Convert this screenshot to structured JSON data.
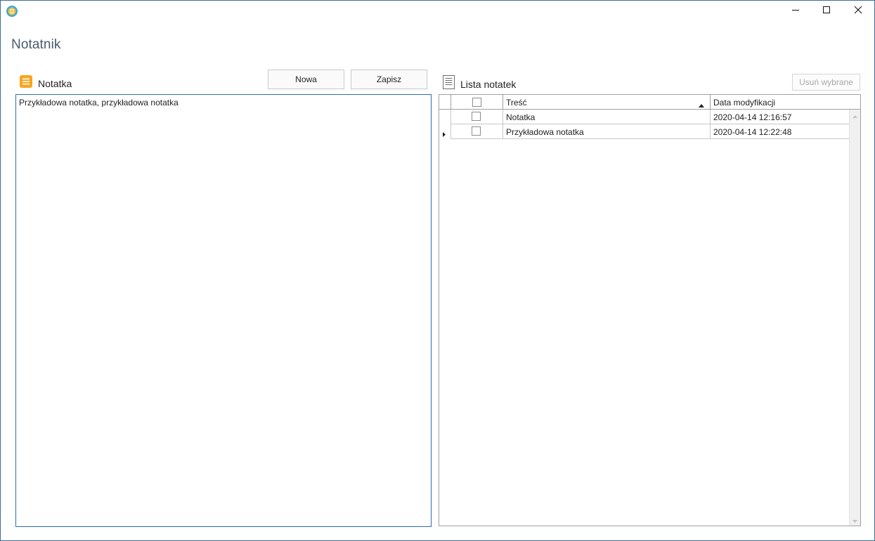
{
  "window": {
    "title": "Notatnik",
    "icon": "app-icon",
    "controls": [
      "minimize-icon",
      "maximize-icon",
      "close-icon"
    ]
  },
  "note_section": {
    "title": "Notatka",
    "icon": "note-icon",
    "new_button": "Nowa",
    "save_button": "Zapisz",
    "content": "Przykładowa notatka, przykładowa notatka"
  },
  "list_section": {
    "title": "Lista notatek",
    "icon": "document-list-icon",
    "delete_button": "Usuń wybrane",
    "delete_enabled": false
  },
  "grid": {
    "columns": [
      "Treść",
      "Data modyfikacji"
    ],
    "sorted_column": "Treść",
    "sort_direction": "ascending",
    "rows": [
      {
        "content": "Notatka",
        "modified": "2020-04-14 12:16:57",
        "checked": false,
        "current": false
      },
      {
        "content": "Przykładowa notatka",
        "modified": "2020-04-14 12:22:48",
        "checked": false,
        "current": true
      }
    ]
  },
  "colors": {
    "accent": "#2b6fb2",
    "note_icon": "#f7a51e",
    "window_border": "#3d6e99"
  }
}
